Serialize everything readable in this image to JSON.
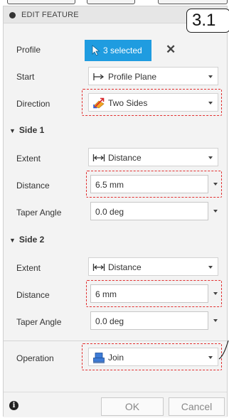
{
  "header": {
    "title": "EDIT FEATURE"
  },
  "step_badge": "3.1",
  "profile": {
    "label": "Profile",
    "selection": "3 selected"
  },
  "start": {
    "label": "Start",
    "value": "Profile Plane"
  },
  "direction": {
    "label": "Direction",
    "value": "Two Sides"
  },
  "side1": {
    "heading": "Side 1",
    "extent_label": "Extent",
    "extent_value": "Distance",
    "distance_label": "Distance",
    "distance_value": "6.5 mm",
    "taper_label": "Taper Angle",
    "taper_value": "0.0 deg"
  },
  "side2": {
    "heading": "Side 2",
    "extent_label": "Extent",
    "extent_value": "Distance",
    "distance_label": "Distance",
    "distance_value": "6 mm",
    "taper_label": "Taper Angle",
    "taper_value": "0.0 deg"
  },
  "operation": {
    "label": "Operation",
    "value": "Join"
  },
  "footer": {
    "ok_label": "OK",
    "cancel_label": "Cancel"
  },
  "colors": {
    "selection_blue": "#1f9ce0",
    "highlight_red": "#e23030",
    "panel_bg": "#f3f3f3"
  },
  "icons": {
    "header": "circle-bullet-icon",
    "profile": "cursor-arrow-icon",
    "clear": "close-icon",
    "start": "arrow-from-line-icon",
    "direction": "two-sides-icon",
    "extent": "distance-arrows-icon",
    "operation": "join-icon",
    "info": "info-icon"
  }
}
